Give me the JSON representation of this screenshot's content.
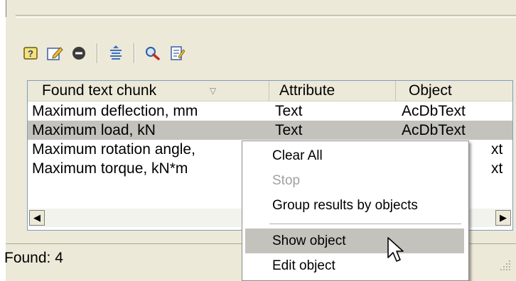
{
  "toolbar": {
    "icons": [
      "help-icon",
      "edit-icon",
      "stop-icon",
      "align-icon",
      "search-icon",
      "notes-icon"
    ]
  },
  "results": {
    "columns": [
      {
        "label": "Found text chunk",
        "sort": "descending"
      },
      {
        "label": "Attribute"
      },
      {
        "label": "Object"
      }
    ],
    "rows": [
      {
        "chunk": "Maximum deflection, mm",
        "attribute": "Text",
        "object": "AcDbText"
      },
      {
        "chunk": "Maximum load, kN",
        "attribute": "Text",
        "object": "AcDbText"
      },
      {
        "chunk": "Maximum rotation angle,",
        "attribute": "",
        "object": "xt"
      },
      {
        "chunk": "Maximum torque, kN*m",
        "attribute": "",
        "object": "xt"
      }
    ],
    "selected_row": 1
  },
  "status": {
    "found_label": "Found: 4"
  },
  "context_menu": {
    "items": [
      {
        "label": "Clear All",
        "enabled": true
      },
      {
        "label": "Stop",
        "enabled": false
      },
      {
        "label": "Group results by objects",
        "enabled": true
      },
      {
        "label": "Show object",
        "enabled": true,
        "hovered": true
      },
      {
        "label": "Edit object",
        "enabled": true
      }
    ]
  },
  "colors": {
    "window": "#ece9d8",
    "selection": "#c3c2bd",
    "list_border": "#7f9db9"
  }
}
